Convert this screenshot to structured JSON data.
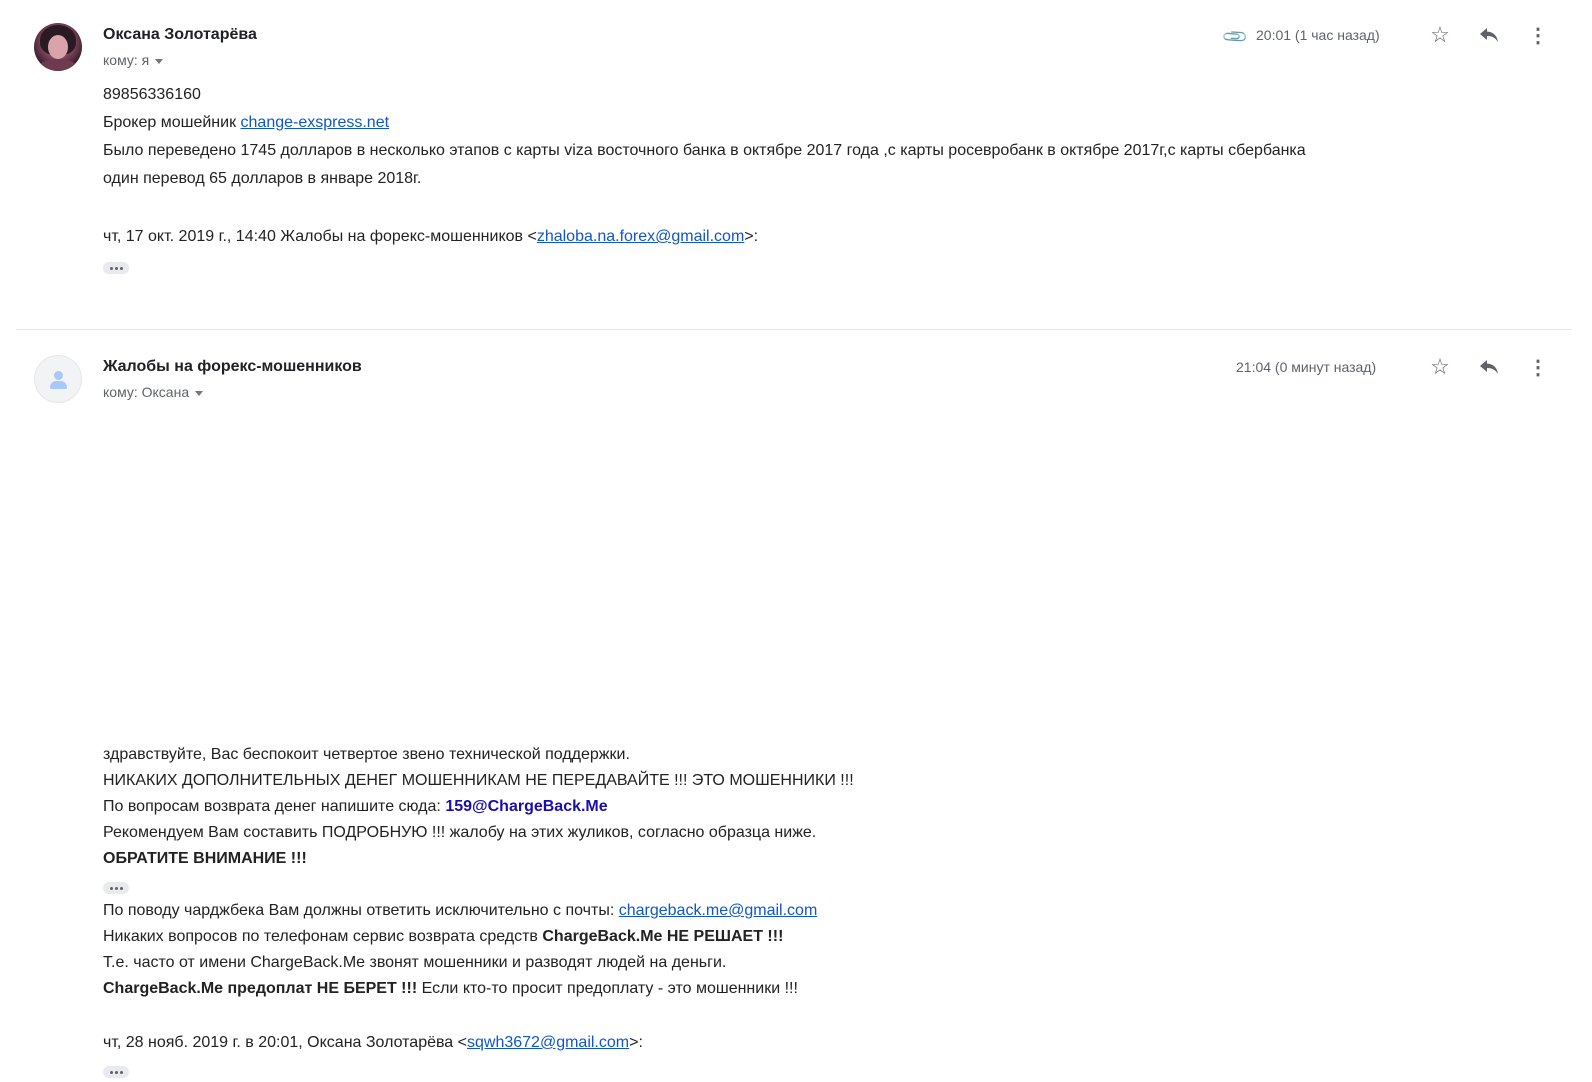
{
  "message1": {
    "sender": "Оксана Золотарёва",
    "to": "кому: я",
    "time": "20:01 (1 час назад)",
    "icons": {
      "attachment": "paperclip-icon",
      "star": "star-icon",
      "reply": "reply-icon",
      "more": "more-vert-icon"
    },
    "body": {
      "phone": "89856336160",
      "line2_prefix": "Брокер мошейник ",
      "line2_link": "change-exspress.net",
      "line3": "Было переведено 1745 долларов в несколько этапов с карты viza  восточного банка в октябре 2017 года ,с карты росевробанк в октябре 2017г,с карты сбербанка",
      "line4": "один перевод 65 долларов в январе 2018г.",
      "quote_prefix": "чт, 17 окт. 2019 г., 14:40 Жалобы на форекс-мошенников <",
      "quote_email": "zhaloba.na.forex@gmail.com",
      "quote_suffix": ">:"
    }
  },
  "message2": {
    "sender": "Жалобы на форекс-мошенников",
    "to": "кому: Оксана",
    "time": "21:04 (0 минут назад)",
    "icons": {
      "avatar": "person-icon",
      "star": "star-icon",
      "reply": "reply-icon",
      "more": "more-vert-icon"
    },
    "body": {
      "l1": "здравствуйте, Вас беспокоит четвертое звено технической поддержки.",
      "l2": "НИКАКИХ ДОПОЛНИТЕЛЬНЫХ ДЕНЕГ МОШЕННИКАМ НЕ ПЕРЕДАВАЙТЕ !!! ЭТО МОШЕННИКИ !!!",
      "l3_prefix": "По вопросам возврата денег напишите сюда: ",
      "l3_email": "159@ChargeBack.Me",
      "l4": "Рекомендуем Вам составить ПОДРОБНУЮ !!! жалобу на этих жуликов, согласно образца ниже.",
      "l5": "ОБРАТИТЕ ВНИМАНИЕ !!!",
      "l6_prefix": "По поводу чарджбека Вам должны ответить исключительно с почты: ",
      "l6_email": "chargeback.me@gmail.com",
      "l7_prefix": "Никаких вопросов по телефонам сервис возврата средств ",
      "l7_bold": "ChargeBack.Me НЕ РЕШАЕТ !!!",
      "l8": "Т.е. часто от имени ChargeBack.Me звонят мошенники и разводят людей на деньги.",
      "l9_bold": "ChargeBack.Me предоплат НЕ БЕРЕТ !!!",
      "l9_suffix": " Если кто-то просит предоплату - это мошенники !!!",
      "quote_prefix": "чт, 28 нояб. 2019 г. в 20:01, Оксана Золотарёва <",
      "quote_email": "sqwh3672@gmail.com",
      "quote_suffix": ">:"
    }
  }
}
